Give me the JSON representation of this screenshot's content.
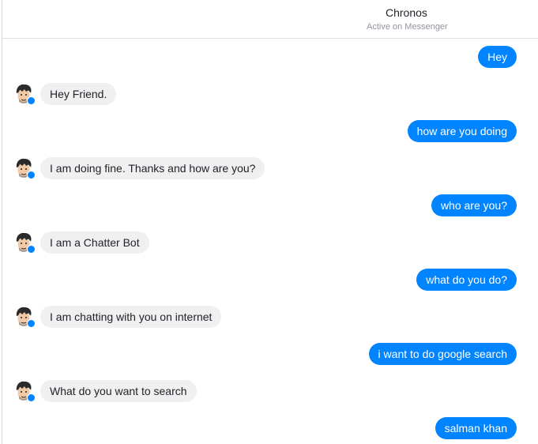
{
  "header": {
    "title": "Chronos",
    "status": "Active on Messenger"
  },
  "colors": {
    "outgoing_bubble": "#0084ff",
    "incoming_bubble": "#f1f0f0",
    "badge": "#0084ff"
  },
  "icons": {
    "avatar": "cartoon-face-avatar",
    "badge": "messenger-badge-icon"
  },
  "messages": [
    {
      "side": "out",
      "text": "Hey"
    },
    {
      "side": "in",
      "text": "Hey Friend."
    },
    {
      "side": "out",
      "text": "how are you doing"
    },
    {
      "side": "in",
      "text": "I am doing fine. Thanks and how are you?"
    },
    {
      "side": "out",
      "text": "who are you?"
    },
    {
      "side": "in",
      "text": "I am a Chatter Bot"
    },
    {
      "side": "out",
      "text": "what do you do?"
    },
    {
      "side": "in",
      "text": "I am chatting with you on internet"
    },
    {
      "side": "out",
      "text": "i want to do google search"
    },
    {
      "side": "in",
      "text": "What do you want to search"
    },
    {
      "side": "out",
      "text": "salman khan"
    }
  ]
}
